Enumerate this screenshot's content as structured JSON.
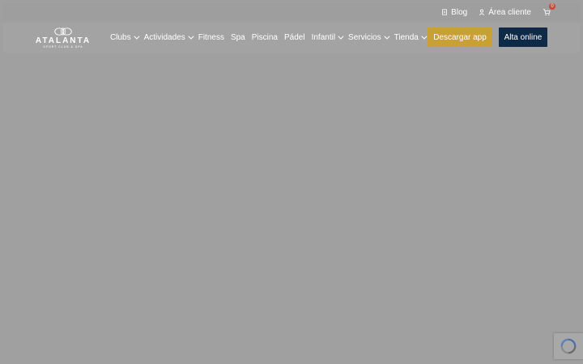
{
  "topbar": {
    "blog_label": "Blog",
    "account_label": "Área cliente",
    "cart_count": "0"
  },
  "logo": {
    "word": "ATALANTA",
    "sub": "SPORT CLUB & SPA"
  },
  "nav": {
    "items": [
      {
        "label": "Clubs",
        "dropdown": true
      },
      {
        "label": "Actividades",
        "dropdown": true
      },
      {
        "label": "Fitness",
        "dropdown": false
      },
      {
        "label": "Spa",
        "dropdown": false
      },
      {
        "label": "Piscina",
        "dropdown": false
      },
      {
        "label": "Pádel",
        "dropdown": false
      },
      {
        "label": "Infantil",
        "dropdown": true
      },
      {
        "label": "Servicios",
        "dropdown": true
      },
      {
        "label": "Tienda",
        "dropdown": true
      }
    ]
  },
  "actions": {
    "download_label": "Descargar app",
    "signup_label": "Alta online"
  },
  "colors": {
    "overlay": "#a0a0a0",
    "download_button": "#c9a036",
    "signup_button": "#0f2a47",
    "cart_badge": "#c84a3a"
  }
}
